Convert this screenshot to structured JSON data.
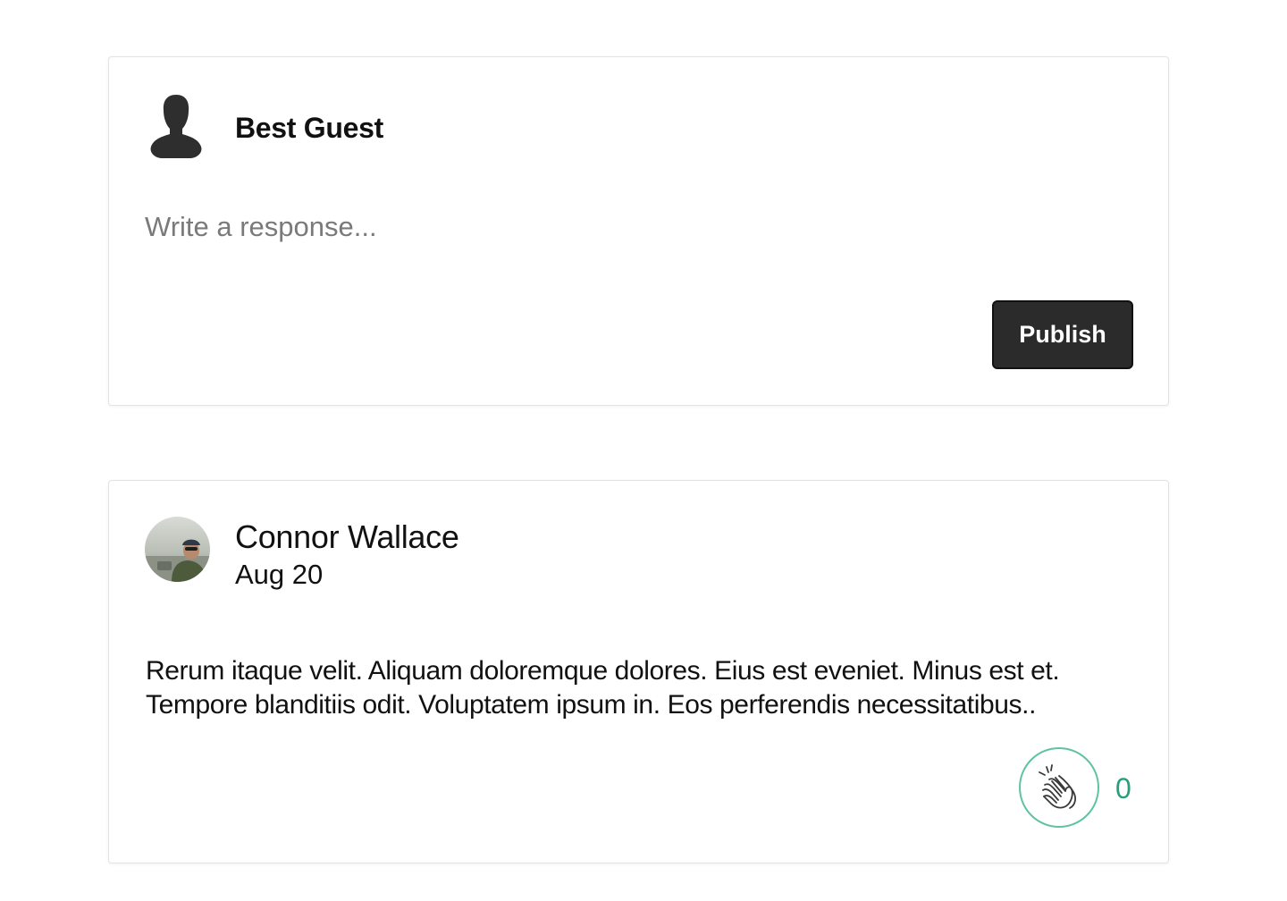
{
  "composer": {
    "user_name": "Best Guest",
    "avatar_icon": "user-silhouette-icon",
    "input_placeholder": "Write a response...",
    "input_value": "",
    "publish_label": "Publish"
  },
  "response": {
    "author_name": "Connor Wallace",
    "date": "Aug 20",
    "body": "Rerum itaque velit. Aliquam doloremque dolores. Eius est eveniet. Minus est et. Tempore blanditiis odit. Voluptatem ipsum in. Eos perferendis necessitatibus..",
    "clap_icon": "clapping-hands-icon",
    "clap_count": "0"
  },
  "colors": {
    "button_bg": "#2b2b2b",
    "clap_accent": "#5fc3a2",
    "clap_count": "#2a9d7c",
    "card_border": "#e3e3e3"
  }
}
